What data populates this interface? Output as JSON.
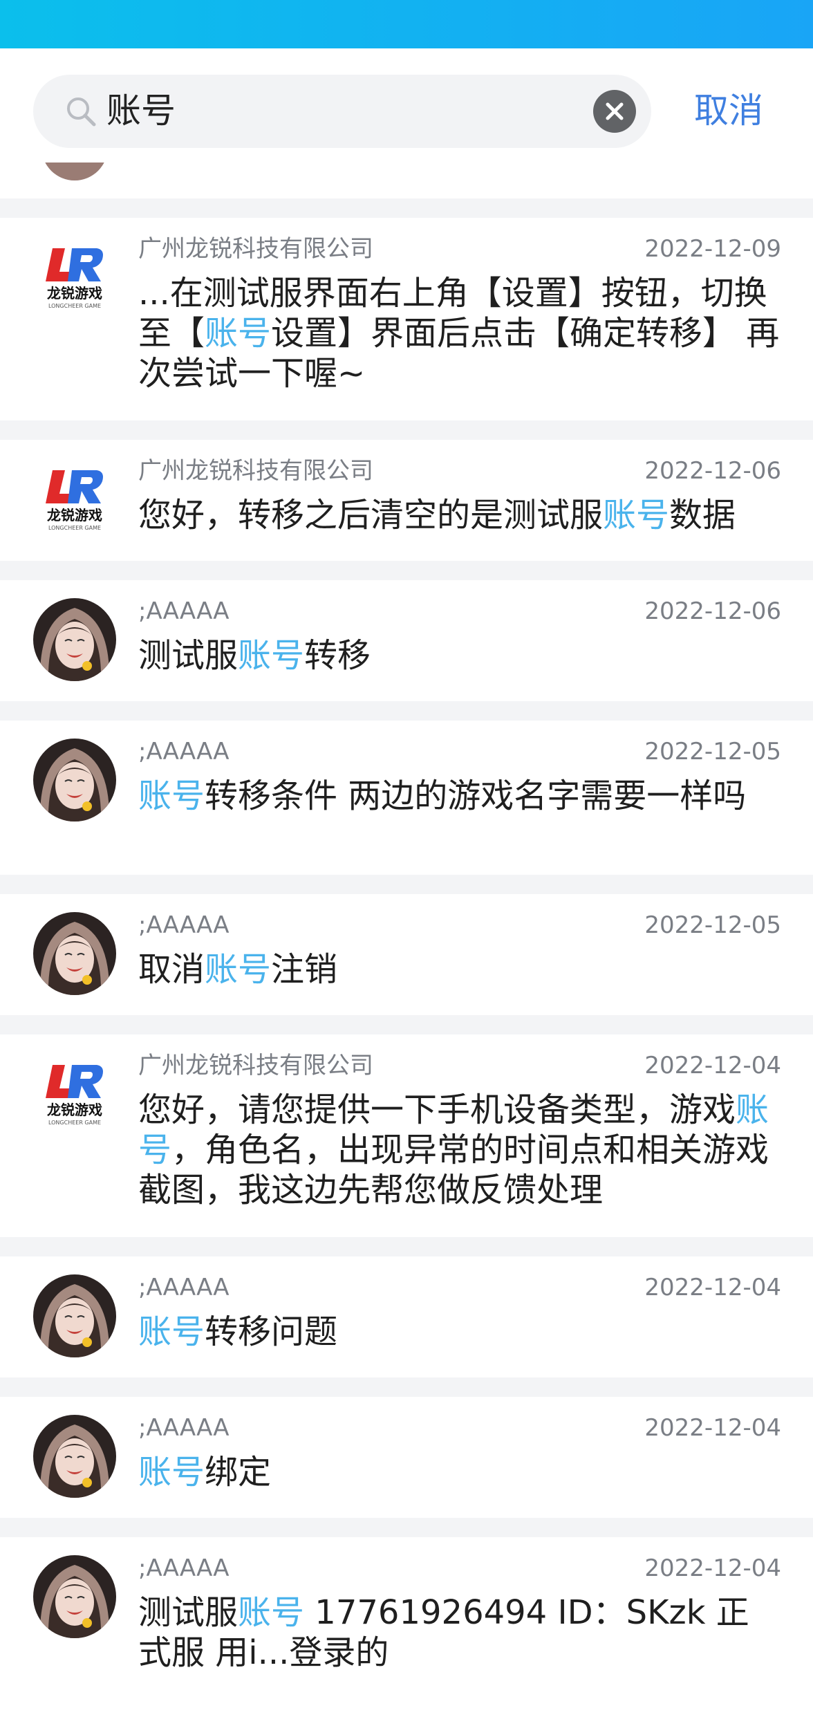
{
  "search": {
    "query": "账号",
    "cancel_label": "取消"
  },
  "results": [
    {
      "kind": "company",
      "name": "广州龙锐科技有限公司",
      "date": "2022-12-09",
      "parts": [
        {
          "t": "...在测试服界面右上角【设置】按钮，切换至【",
          "h": false
        },
        {
          "t": "账号",
          "h": true
        },
        {
          "t": "设置】界面后点击【确定转移】 再次尝试一下喔~",
          "h": false
        }
      ]
    },
    {
      "kind": "company",
      "name": "广州龙锐科技有限公司",
      "date": "2022-12-06",
      "parts": [
        {
          "t": "您好，转移之后清空的是测试服",
          "h": false
        },
        {
          "t": "账号",
          "h": true
        },
        {
          "t": "数据",
          "h": false
        }
      ]
    },
    {
      "kind": "user",
      "name": ";AAAAA",
      "date": "2022-12-06",
      "parts": [
        {
          "t": "测试服",
          "h": false
        },
        {
          "t": "账号",
          "h": true
        },
        {
          "t": "转移",
          "h": false
        }
      ]
    },
    {
      "kind": "user",
      "name": ";AAAAA",
      "date": "2022-12-05",
      "parts": [
        {
          "t": "账号",
          "h": true
        },
        {
          "t": "转移条件   两边的游戏名字需要一样吗",
          "h": false
        }
      ]
    },
    {
      "kind": "user",
      "name": ";AAAAA",
      "date": "2022-12-05",
      "parts": [
        {
          "t": "取消",
          "h": false
        },
        {
          "t": "账号",
          "h": true
        },
        {
          "t": "注销",
          "h": false
        }
      ]
    },
    {
      "kind": "company",
      "name": "广州龙锐科技有限公司",
      "date": "2022-12-04",
      "parts": [
        {
          "t": "您好，请您提供一下手机设备类型，游戏",
          "h": false
        },
        {
          "t": "账号",
          "h": true
        },
        {
          "t": "，角色名，出现异常的时间点和相关游戏截图，我这边先帮您做反馈处理",
          "h": false
        }
      ]
    },
    {
      "kind": "user",
      "name": ";AAAAA",
      "date": "2022-12-04",
      "parts": [
        {
          "t": "账号",
          "h": true
        },
        {
          "t": "转移问题",
          "h": false
        }
      ]
    },
    {
      "kind": "user",
      "name": ";AAAAA",
      "date": "2022-12-04",
      "parts": [
        {
          "t": "账号",
          "h": true
        },
        {
          "t": "绑定",
          "h": false
        }
      ]
    },
    {
      "kind": "user",
      "name": ";AAAAA",
      "date": "2022-12-04",
      "parts": [
        {
          "t": "测试服",
          "h": false
        },
        {
          "t": "账号",
          "h": true
        },
        {
          "t": " 17761926494   ID：SKzk 正式服 用i...登录的",
          "h": false
        }
      ]
    }
  ],
  "logo": {
    "text": "龙锐游戏",
    "subtext": "LONGCHEER GAME",
    "mark": "LR"
  },
  "colors": {
    "accent": "#3f7fe0",
    "highlight": "#4ab3ec",
    "header_start": "#0bbfec",
    "header_end": "#19a5f6"
  }
}
